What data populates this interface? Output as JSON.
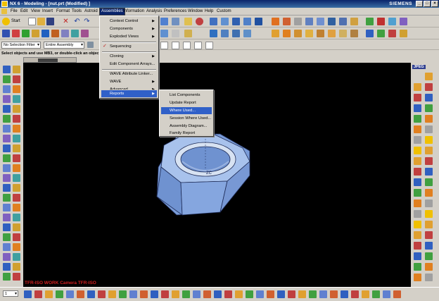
{
  "window": {
    "title": "NX 6 - Modeling - [nut.prt (Modified) ]",
    "brand": "SIEMENS",
    "controls": [
      "_",
      "□",
      "×"
    ]
  },
  "menubar": {
    "items": [
      "File",
      "Edit",
      "View",
      "Insert",
      "Format",
      "Tools",
      "Astroid",
      "Assemblies",
      "Information",
      "Analysis",
      "Preferences",
      "Window",
      "Help",
      "Custom"
    ],
    "active": "Assemblies"
  },
  "toolbar": {
    "start_label": "Start",
    "selection_filter": "No Selection Filter",
    "scope": "Entire Assembly"
  },
  "status": {
    "prompt": "Select objects and use MB3, or double-click an objec"
  },
  "assemblies_menu": {
    "items": [
      {
        "label": "Context Control",
        "submenu": true
      },
      {
        "label": "Components",
        "submenu": true
      },
      {
        "label": "Exploded Views",
        "submenu": true
      },
      {
        "label": "Sequencing",
        "submenu": false,
        "checked": true
      },
      {
        "label": "Cloning",
        "submenu": true
      },
      {
        "label": "Edit Component Arrays...",
        "submenu": false
      },
      {
        "label": "WAVE Attribute Linker...",
        "submenu": false
      },
      {
        "label": "WAVE",
        "submenu": true
      },
      {
        "label": "Advanced",
        "submenu": true
      },
      {
        "label": "Reports",
        "submenu": true,
        "highlighted": true
      }
    ]
  },
  "reports_submenu": {
    "items": [
      {
        "label": "List Components"
      },
      {
        "label": "Update Report"
      },
      {
        "label": "Where Used...",
        "highlighted": true
      },
      {
        "label": "Session Where Used..."
      },
      {
        "label": "Assembly Diagram..."
      },
      {
        "label": "Family Report"
      }
    ]
  },
  "viewport": {
    "view_label": "TFR-ISO WORK Camera TFR-ISO",
    "axis_label": "ZC",
    "background": "#000000",
    "part_color": "#8fb3e6"
  },
  "right_panel": {
    "jpeg_label": "JPEG"
  },
  "bottom": {
    "layer_value": "1"
  }
}
